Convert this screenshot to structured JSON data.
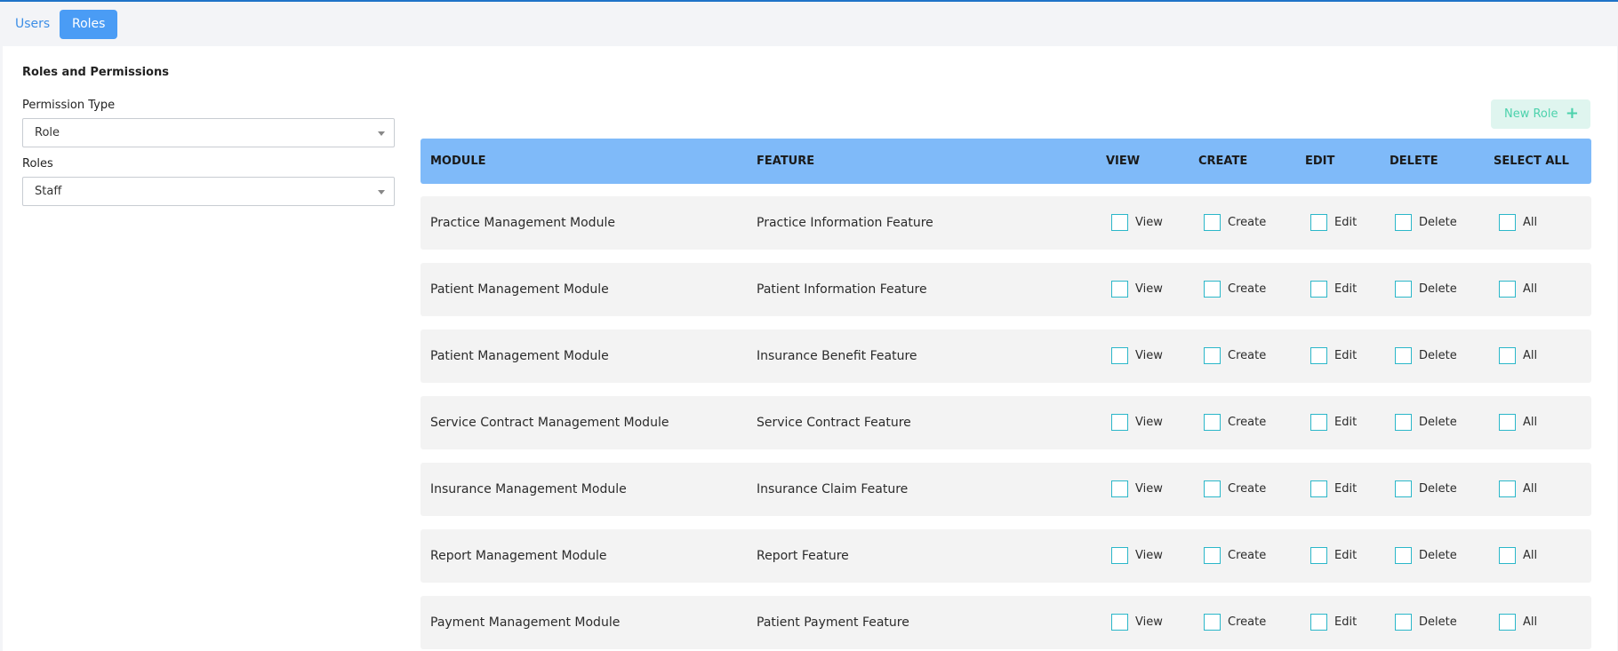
{
  "tabs": [
    {
      "label": "Users",
      "active": false
    },
    {
      "label": "Roles",
      "active": true
    }
  ],
  "card": {
    "title": "Roles and Permissions",
    "permission_type": {
      "label": "Permission Type",
      "value": "Role"
    },
    "roles": {
      "label": "Roles",
      "value": "Staff"
    },
    "new_role_button": "New Role",
    "new_role_icon": "plus-icon"
  },
  "table": {
    "headers": {
      "module": "MODULE",
      "feature": "FEATURE",
      "view": "VIEW",
      "create": "CREATE",
      "edit": "EDIT",
      "delete": "DELETE",
      "select_all": "SELECT ALL"
    },
    "checkbox_labels": {
      "view": "View",
      "create": "Create",
      "edit": "Edit",
      "delete": "Delete",
      "all": "All"
    },
    "rows": [
      {
        "module": "Practice Management Module",
        "feature": "Practice Information Feature"
      },
      {
        "module": "Patient Management Module",
        "feature": "Patient Information Feature"
      },
      {
        "module": "Patient Management Module",
        "feature": "Insurance Benefit Feature"
      },
      {
        "module": "Service Contract Management Module",
        "feature": "Service Contract Feature"
      },
      {
        "module": "Insurance Management Module",
        "feature": "Insurance Claim Feature"
      },
      {
        "module": "Report Management Module",
        "feature": "Report Feature"
      },
      {
        "module": "Payment Management Module",
        "feature": "Patient Payment Feature"
      }
    ]
  },
  "colors": {
    "header_bg": "#7fbaf9",
    "active_tab": "#4a9cf5",
    "new_role_bg": "#dff5ef",
    "new_role_text": "#4cd2ac",
    "checkbox_border": "#2bb7c9"
  }
}
